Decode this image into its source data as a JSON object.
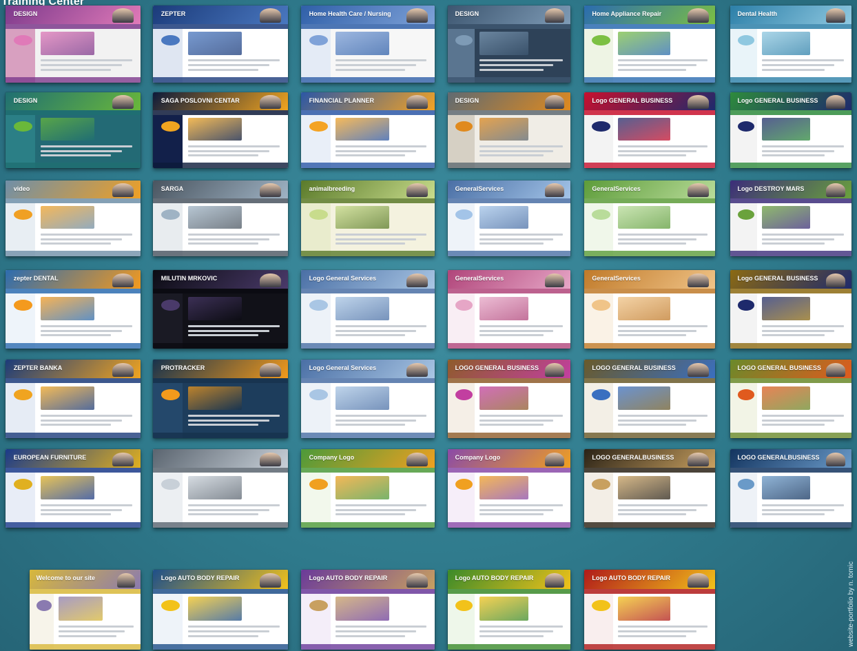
{
  "page": {
    "title": "Training Center",
    "caption": "website-portfolio by n. tomic"
  },
  "thumbnails": [
    {
      "name": "thumb-design-2005",
      "label": "DESIGN",
      "theme": [
        "#7d3a8c",
        "#e07ab8",
        "#f2f2f2",
        "#d8a0c0"
      ]
    },
    {
      "name": "thumb-zepter-training",
      "label": "ZEPTER",
      "theme": [
        "#1b3b7a",
        "#4a78c0",
        "#ffffff",
        "#dfe6f2"
      ]
    },
    {
      "name": "thumb-home-health-care",
      "label": "Home Health Care / Nursing",
      "theme": [
        "#2f5fa8",
        "#7fa2d8",
        "#f7f7f7",
        "#e4ebf6"
      ]
    },
    {
      "name": "thumb-design-dark",
      "label": "DESIGN",
      "theme": [
        "#3d5670",
        "#7e9bb6",
        "#2e4258",
        "#5a7590"
      ]
    },
    {
      "name": "thumb-home-appliance-repair",
      "label": "Home Appliance Repair",
      "theme": [
        "#2a6bb0",
        "#7cc043",
        "#ffffff",
        "#eef4e4"
      ]
    },
    {
      "name": "thumb-dental-health",
      "label": "Dental Health",
      "theme": [
        "#2c7fa8",
        "#8fc8e0",
        "#ffffff",
        "#e9f4f9"
      ]
    },
    {
      "name": "thumb-design-green-arrow",
      "label": "DESIGN",
      "theme": [
        "#1f6f72",
        "#6ab83a",
        "#236a75",
        "#2b7f86"
      ]
    },
    {
      "name": "thumb-saga-poslovni",
      "label": "SAGA POSLOVNI CENTAR",
      "theme": [
        "#0d1a3a",
        "#f0a420",
        "#ffffff",
        "#12204a"
      ]
    },
    {
      "name": "thumb-financial-planner",
      "label": "FINANCIAL PLANNER",
      "theme": [
        "#2b57a6",
        "#f4a324",
        "#ffffff",
        "#e9eff8"
      ]
    },
    {
      "name": "thumb-design-brown",
      "label": "DESIGN",
      "theme": [
        "#5f6a72",
        "#e08a1e",
        "#f0ede6",
        "#d6d0c4"
      ]
    },
    {
      "name": "thumb-logo-general-red",
      "label": "Logo GENERAL BUSINESS",
      "theme": [
        "#c8102e",
        "#1e2a6c",
        "#ffffff",
        "#f3f3f3"
      ]
    },
    {
      "name": "thumb-logo-general-green",
      "label": "Logo GENERAL BUSINESS",
      "theme": [
        "#2e8b3c",
        "#1e2a6c",
        "#ffffff",
        "#f3f3f3"
      ]
    },
    {
      "name": "thumb-video-white",
      "label": "video",
      "theme": [
        "#6f8fa8",
        "#f0a024",
        "#ffffff",
        "#e8eef3"
      ]
    },
    {
      "name": "thumb-sarga-dms",
      "label": "SARGA",
      "theme": [
        "#4a5560",
        "#9fb3c4",
        "#ffffff",
        "#e8ecef"
      ]
    },
    {
      "name": "thumb-animal-breeding",
      "label": "animalbreeding",
      "theme": [
        "#5a7a2a",
        "#c8dc8c",
        "#f4f2df",
        "#e9eccd"
      ]
    },
    {
      "name": "thumb-general-services-blue",
      "label": "GeneralServices",
      "theme": [
        "#4a6fa5",
        "#a3c4e8",
        "#ffffff",
        "#eef3f9"
      ]
    },
    {
      "name": "thumb-general-services-green",
      "label": "GeneralServices",
      "theme": [
        "#5d9c3a",
        "#b9dc9a",
        "#ffffff",
        "#f0f7ea"
      ]
    },
    {
      "name": "thumb-logo-general-purple",
      "label": "Logo DESTROY MARS",
      "theme": [
        "#3c2d7a",
        "#6aa23c",
        "#ffffff",
        "#f3f3f3"
      ]
    },
    {
      "name": "thumb-zepter-dental",
      "label": "zepter DENTAL",
      "theme": [
        "#2c6cb0",
        "#f49a1e",
        "#ffffff",
        "#eef4fa"
      ]
    },
    {
      "name": "thumb-milutin-mrkovic",
      "label": "MILUTIN MRKOVIC",
      "theme": [
        "#0b0b12",
        "#4a3a6a",
        "#111118",
        "#1a1a24"
      ]
    },
    {
      "name": "thumb-logo-general-services-1",
      "label": "Logo General Services",
      "theme": [
        "#4a6fa5",
        "#a9c6e4",
        "#ffffff",
        "#edf2f8"
      ]
    },
    {
      "name": "thumb-general-services-pink",
      "label": "GeneralServices",
      "theme": [
        "#b0457a",
        "#e6a6c6",
        "#ffffff",
        "#f9eef4"
      ]
    },
    {
      "name": "thumb-general-services-orange",
      "label": "GeneralServices",
      "theme": [
        "#c07a2a",
        "#f0c488",
        "#ffffff",
        "#faf2e6"
      ]
    },
    {
      "name": "thumb-logo-general-gold",
      "label": "Logo GENERAL BUSINESS",
      "theme": [
        "#8c6a12",
        "#1e2a6c",
        "#ffffff",
        "#f3f3f3"
      ]
    },
    {
      "name": "thumb-zepter-banking",
      "label": "ZEPTER BANKA",
      "theme": [
        "#1b3b7a",
        "#f0a420",
        "#ffffff",
        "#e6ecf5"
      ]
    },
    {
      "name": "thumb-protracker",
      "label": "PROTRACKER",
      "theme": [
        "#17324d",
        "#f29a1c",
        "#1d3d5c",
        "#24486b"
      ]
    },
    {
      "name": "thumb-logo-general-services-2",
      "label": "Logo General Services",
      "theme": [
        "#4a6fa5",
        "#a9c6e4",
        "#ffffff",
        "#edf2f8"
      ]
    },
    {
      "name": "thumb-logo-general-business-magenta",
      "label": "LOGO GENERAL BUSINESS",
      "theme": [
        "#8e5c2a",
        "#c23fa0",
        "#ffffff",
        "#f5efe7"
      ]
    },
    {
      "name": "thumb-logo-general-business-blue",
      "label": "LOGO GENERAL BUSINESS",
      "theme": [
        "#6a5a2a",
        "#3a6fc0",
        "#ffffff",
        "#f3efe6"
      ]
    },
    {
      "name": "thumb-logo-general-business-green",
      "label": "LOGO GENERAL BUSINESS",
      "theme": [
        "#6a8a2a",
        "#e05a1e",
        "#ffffff",
        "#f2f4e6"
      ]
    },
    {
      "name": "thumb-european-furniture",
      "label": "EUROPEAN FURNITURE",
      "theme": [
        "#1a3a8a",
        "#e0b020",
        "#ffffff",
        "#e8edf7"
      ]
    },
    {
      "name": "thumb-silver-corporate",
      "label": "",
      "theme": [
        "#5b6570",
        "#c8d0d8",
        "#ffffff",
        "#eceff2"
      ]
    },
    {
      "name": "thumb-company-logo-green",
      "label": "Company Logo",
      "theme": [
        "#4c9a3a",
        "#f0a020",
        "#ffffff",
        "#f2f8ec"
      ]
    },
    {
      "name": "thumb-company-logo-purple",
      "label": "Company Logo",
      "theme": [
        "#8a4aa8",
        "#f0a020",
        "#ffffff",
        "#f6eef9"
      ]
    },
    {
      "name": "thumb-logo-generalbusiness-dark",
      "label": "LOGO GENERALBUSINESS",
      "theme": [
        "#2a2216",
        "#c8a060",
        "#ffffff",
        "#f3eee6"
      ]
    },
    {
      "name": "thumb-logo-generalbusiness-navy",
      "label": "LOGO GENERALBUSINESS",
      "theme": [
        "#13345f",
        "#6a9ac8",
        "#ffffff",
        "#eef2f7"
      ]
    },
    {
      "name": "thumb-welcome-yellow",
      "label": "Welcome to our site",
      "theme": [
        "#d8b83a",
        "#8a7ab0",
        "#ffffff",
        "#f7f4ea"
      ]
    },
    {
      "name": "thumb-auto-body-blue",
      "label": "Logo AUTO BODY REPAIR",
      "theme": [
        "#1e4f8a",
        "#f2c21a",
        "#ffffff",
        "#eef3f9"
      ]
    },
    {
      "name": "thumb-auto-body-purple",
      "label": "Logo AUTO BODY REPAIR",
      "theme": [
        "#6a3a9a",
        "#c8a060",
        "#ffffff",
        "#f4eef9"
      ]
    },
    {
      "name": "thumb-auto-body-green",
      "label": "Logo AUTO BODY REPAIR",
      "theme": [
        "#3a8a2a",
        "#f2c21a",
        "#ffffff",
        "#eef7ea"
      ]
    },
    {
      "name": "thumb-auto-body-red",
      "label": "Logo AUTO BODY REPAIR",
      "theme": [
        "#b01a1a",
        "#f2c21a",
        "#ffffff",
        "#f9eeee"
      ]
    }
  ]
}
